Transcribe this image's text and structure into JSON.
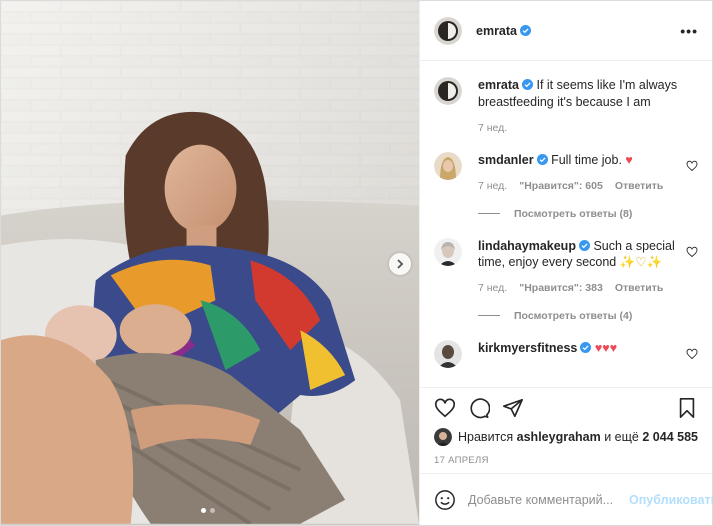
{
  "colors": {
    "verified": "#3897f0",
    "link": "#b2dffc",
    "heart": "#ed4956"
  },
  "media": {
    "dots_count": 2,
    "active_dot": 0
  },
  "header": {
    "username": "emrata",
    "more_label": "•••"
  },
  "caption": {
    "username": "emrata",
    "text": "If it seems like I'm always breastfeeding it's because I am",
    "time": "7 нед."
  },
  "comments": [
    {
      "username": "smdanler",
      "text": "Full time job.",
      "emoji": "♥",
      "time": "7 нед.",
      "likes": "\"Нравится\": 605",
      "reply": "Ответить",
      "view_replies": "Посмотреть ответы (8)"
    },
    {
      "username": "lindahaymakeup",
      "text": "Such a special time, enjoy every second",
      "emoji": "✨♡✨",
      "time": "7 нед.",
      "likes": "\"Нравится\": 383",
      "reply": "Ответить",
      "view_replies": "Посмотреть ответы (4)"
    },
    {
      "username": "kirkmyersfitness",
      "text": "",
      "emoji": "♥♥♥"
    }
  ],
  "likes_line": {
    "prefix": "Нравится",
    "user": "ashleygraham",
    "suffix": "и ещё",
    "count": "2 044 585"
  },
  "date": "17 АПРЕЛЯ",
  "add_comment": {
    "placeholder": "Добавьте комментарий...",
    "publish": "Опубликовать"
  }
}
